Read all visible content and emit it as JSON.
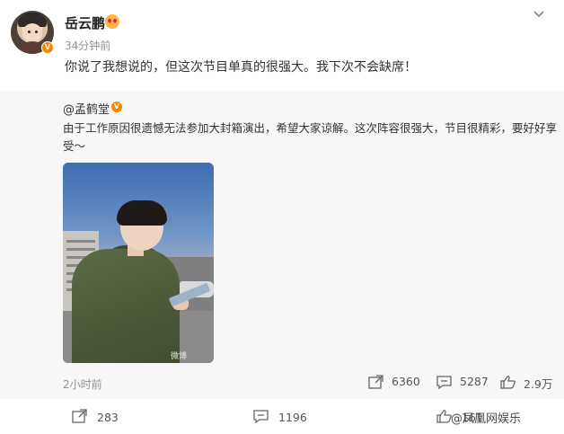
{
  "post": {
    "username": "岳云鹏",
    "timestamp": "34分钟前",
    "text": "你说了我想说的，但这次节目单真的很强大。我下次不会缺席！",
    "badge_icon": "verified-v-icon"
  },
  "repost": {
    "author": "@孟鹤堂",
    "text": "由于工作原因很遗憾无法参加大封箱演出，希望大家谅解。这次阵容很强大，节目很精彩，要好好享受～",
    "time": "2小时前",
    "stats": {
      "shares": "6360",
      "comments": "5287",
      "likes": "2.9万"
    },
    "photo_watermark": "微博"
  },
  "bottom": {
    "shares": "283",
    "comments": "1196",
    "likes": "161",
    "brand": "@凤凰网娱乐"
  },
  "colors": {
    "accent": "#ff8200",
    "muted": "#939393",
    "repost_bg": "#f7f7f7"
  }
}
